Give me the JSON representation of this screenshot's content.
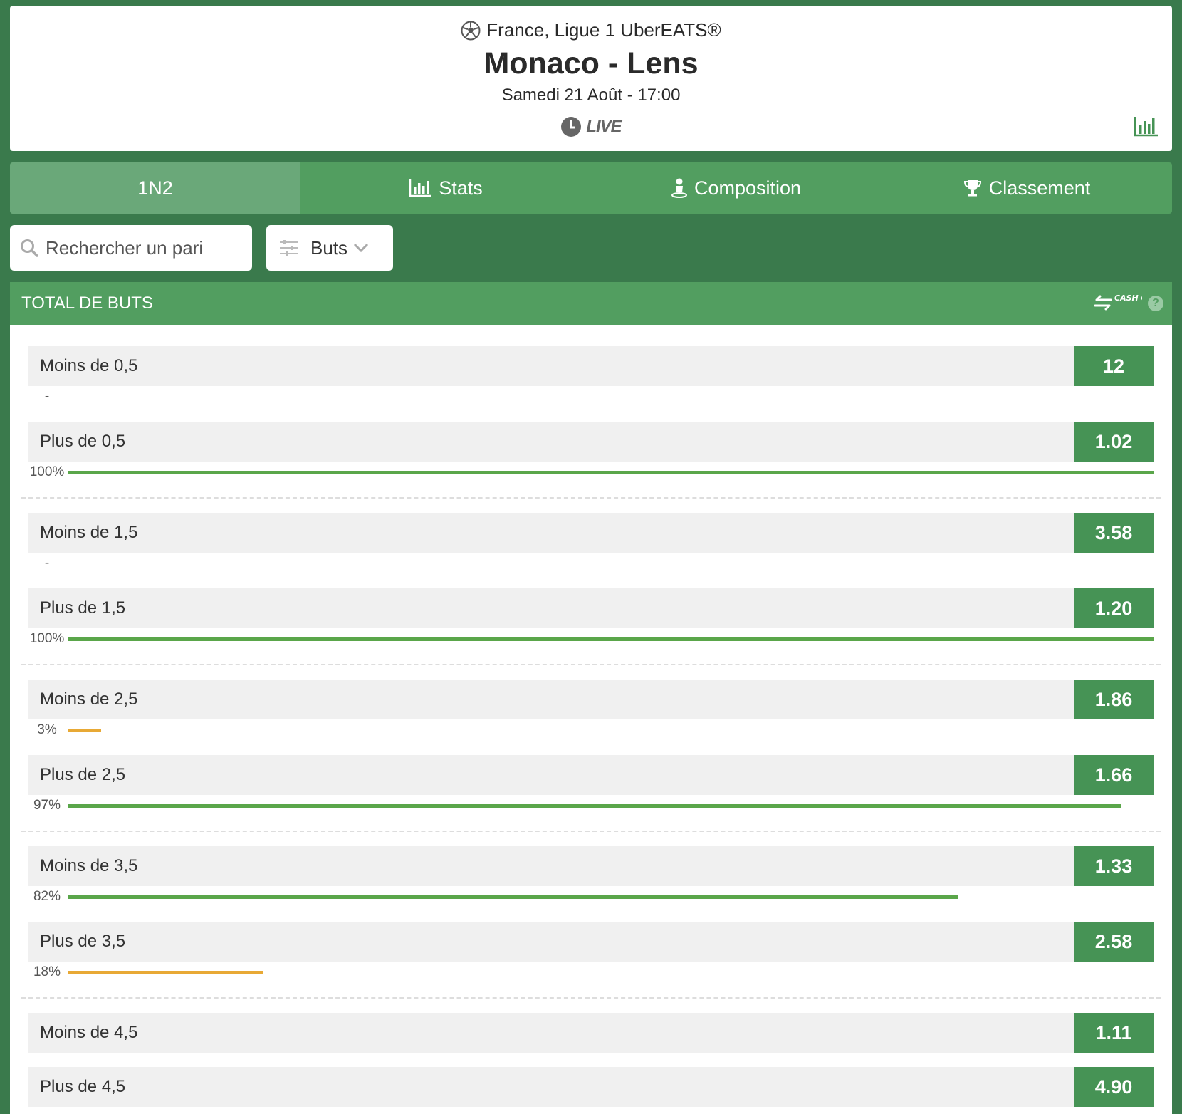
{
  "header": {
    "league": "France, Ligue 1 UberEATS®",
    "match_title": "Monaco - Lens",
    "date": "Samedi 21 Août - 17:00",
    "live_label": "LIVE"
  },
  "tabs": [
    {
      "label": "1N2",
      "active": true
    },
    {
      "label": "Stats",
      "icon": "bar-chart-icon"
    },
    {
      "label": "Composition",
      "icon": "player-icon"
    },
    {
      "label": "Classement",
      "icon": "trophy-icon"
    }
  ],
  "search": {
    "placeholder": "Rechercher un pari"
  },
  "filter": {
    "label": "Buts"
  },
  "market": {
    "title": "TOTAL DE BUTS",
    "cashout_label": "CASH OUT"
  },
  "colors": {
    "green": "#469355",
    "orange": "#e8a935",
    "bar_green": "#5aa64a"
  },
  "selections": [
    {
      "label": "Moins de 0,5",
      "odd": "12",
      "pct_text": "-",
      "pct": null
    },
    {
      "label": "Plus de 0,5",
      "odd": "1.02",
      "pct_text": "100%",
      "pct": 100,
      "color": "green"
    },
    {
      "label": "Moins de 1,5",
      "odd": "3.58",
      "pct_text": "-",
      "pct": null
    },
    {
      "label": "Plus de 1,5",
      "odd": "1.20",
      "pct_text": "100%",
      "pct": 100,
      "color": "green"
    },
    {
      "label": "Moins de 2,5",
      "odd": "1.86",
      "pct_text": "3%",
      "pct": 3,
      "color": "orange"
    },
    {
      "label": "Plus de 2,5",
      "odd": "1.66",
      "pct_text": "97%",
      "pct": 97,
      "color": "green"
    },
    {
      "label": "Moins de 3,5",
      "odd": "1.33",
      "pct_text": "82%",
      "pct": 82,
      "color": "green"
    },
    {
      "label": "Plus de 3,5",
      "odd": "2.58",
      "pct_text": "18%",
      "pct": 18,
      "color": "orange"
    },
    {
      "label": "Moins de 4,5",
      "odd": "1.11",
      "pct_text": null,
      "pct": null
    },
    {
      "label": "Plus de 4,5",
      "odd": "4.90",
      "pct_text": null,
      "pct": null
    }
  ]
}
